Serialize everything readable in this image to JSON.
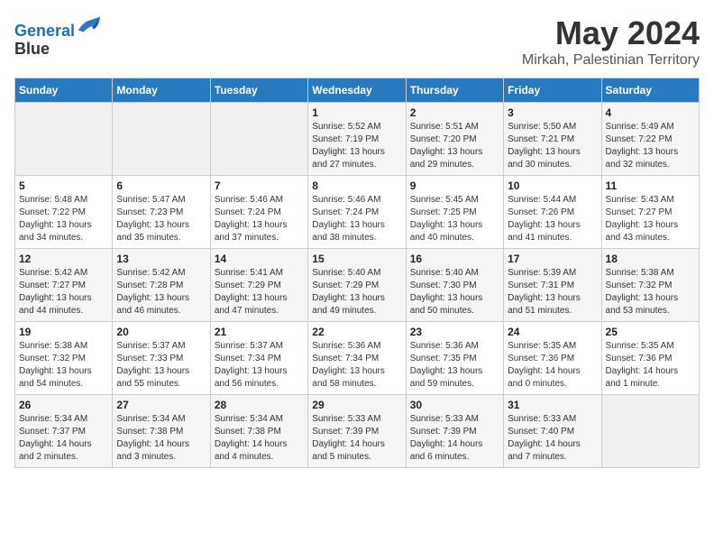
{
  "logo": {
    "line1": "General",
    "line2": "Blue"
  },
  "title": "May 2024",
  "location": "Mirkah, Palestinian Territory",
  "days_of_week": [
    "Sunday",
    "Monday",
    "Tuesday",
    "Wednesday",
    "Thursday",
    "Friday",
    "Saturday"
  ],
  "weeks": [
    [
      {
        "day": "",
        "info": ""
      },
      {
        "day": "",
        "info": ""
      },
      {
        "day": "",
        "info": ""
      },
      {
        "day": "1",
        "info": "Sunrise: 5:52 AM\nSunset: 7:19 PM\nDaylight: 13 hours and 27 minutes."
      },
      {
        "day": "2",
        "info": "Sunrise: 5:51 AM\nSunset: 7:20 PM\nDaylight: 13 hours and 29 minutes."
      },
      {
        "day": "3",
        "info": "Sunrise: 5:50 AM\nSunset: 7:21 PM\nDaylight: 13 hours and 30 minutes."
      },
      {
        "day": "4",
        "info": "Sunrise: 5:49 AM\nSunset: 7:22 PM\nDaylight: 13 hours and 32 minutes."
      }
    ],
    [
      {
        "day": "5",
        "info": "Sunrise: 5:48 AM\nSunset: 7:22 PM\nDaylight: 13 hours and 34 minutes."
      },
      {
        "day": "6",
        "info": "Sunrise: 5:47 AM\nSunset: 7:23 PM\nDaylight: 13 hours and 35 minutes."
      },
      {
        "day": "7",
        "info": "Sunrise: 5:46 AM\nSunset: 7:24 PM\nDaylight: 13 hours and 37 minutes."
      },
      {
        "day": "8",
        "info": "Sunrise: 5:46 AM\nSunset: 7:24 PM\nDaylight: 13 hours and 38 minutes."
      },
      {
        "day": "9",
        "info": "Sunrise: 5:45 AM\nSunset: 7:25 PM\nDaylight: 13 hours and 40 minutes."
      },
      {
        "day": "10",
        "info": "Sunrise: 5:44 AM\nSunset: 7:26 PM\nDaylight: 13 hours and 41 minutes."
      },
      {
        "day": "11",
        "info": "Sunrise: 5:43 AM\nSunset: 7:27 PM\nDaylight: 13 hours and 43 minutes."
      }
    ],
    [
      {
        "day": "12",
        "info": "Sunrise: 5:42 AM\nSunset: 7:27 PM\nDaylight: 13 hours and 44 minutes."
      },
      {
        "day": "13",
        "info": "Sunrise: 5:42 AM\nSunset: 7:28 PM\nDaylight: 13 hours and 46 minutes."
      },
      {
        "day": "14",
        "info": "Sunrise: 5:41 AM\nSunset: 7:29 PM\nDaylight: 13 hours and 47 minutes."
      },
      {
        "day": "15",
        "info": "Sunrise: 5:40 AM\nSunset: 7:29 PM\nDaylight: 13 hours and 49 minutes."
      },
      {
        "day": "16",
        "info": "Sunrise: 5:40 AM\nSunset: 7:30 PM\nDaylight: 13 hours and 50 minutes."
      },
      {
        "day": "17",
        "info": "Sunrise: 5:39 AM\nSunset: 7:31 PM\nDaylight: 13 hours and 51 minutes."
      },
      {
        "day": "18",
        "info": "Sunrise: 5:38 AM\nSunset: 7:32 PM\nDaylight: 13 hours and 53 minutes."
      }
    ],
    [
      {
        "day": "19",
        "info": "Sunrise: 5:38 AM\nSunset: 7:32 PM\nDaylight: 13 hours and 54 minutes."
      },
      {
        "day": "20",
        "info": "Sunrise: 5:37 AM\nSunset: 7:33 PM\nDaylight: 13 hours and 55 minutes."
      },
      {
        "day": "21",
        "info": "Sunrise: 5:37 AM\nSunset: 7:34 PM\nDaylight: 13 hours and 56 minutes."
      },
      {
        "day": "22",
        "info": "Sunrise: 5:36 AM\nSunset: 7:34 PM\nDaylight: 13 hours and 58 minutes."
      },
      {
        "day": "23",
        "info": "Sunrise: 5:36 AM\nSunset: 7:35 PM\nDaylight: 13 hours and 59 minutes."
      },
      {
        "day": "24",
        "info": "Sunrise: 5:35 AM\nSunset: 7:36 PM\nDaylight: 14 hours and 0 minutes."
      },
      {
        "day": "25",
        "info": "Sunrise: 5:35 AM\nSunset: 7:36 PM\nDaylight: 14 hours and 1 minute."
      }
    ],
    [
      {
        "day": "26",
        "info": "Sunrise: 5:34 AM\nSunset: 7:37 PM\nDaylight: 14 hours and 2 minutes."
      },
      {
        "day": "27",
        "info": "Sunrise: 5:34 AM\nSunset: 7:38 PM\nDaylight: 14 hours and 3 minutes."
      },
      {
        "day": "28",
        "info": "Sunrise: 5:34 AM\nSunset: 7:38 PM\nDaylight: 14 hours and 4 minutes."
      },
      {
        "day": "29",
        "info": "Sunrise: 5:33 AM\nSunset: 7:39 PM\nDaylight: 14 hours and 5 minutes."
      },
      {
        "day": "30",
        "info": "Sunrise: 5:33 AM\nSunset: 7:39 PM\nDaylight: 14 hours and 6 minutes."
      },
      {
        "day": "31",
        "info": "Sunrise: 5:33 AM\nSunset: 7:40 PM\nDaylight: 14 hours and 7 minutes."
      },
      {
        "day": "",
        "info": ""
      }
    ]
  ]
}
